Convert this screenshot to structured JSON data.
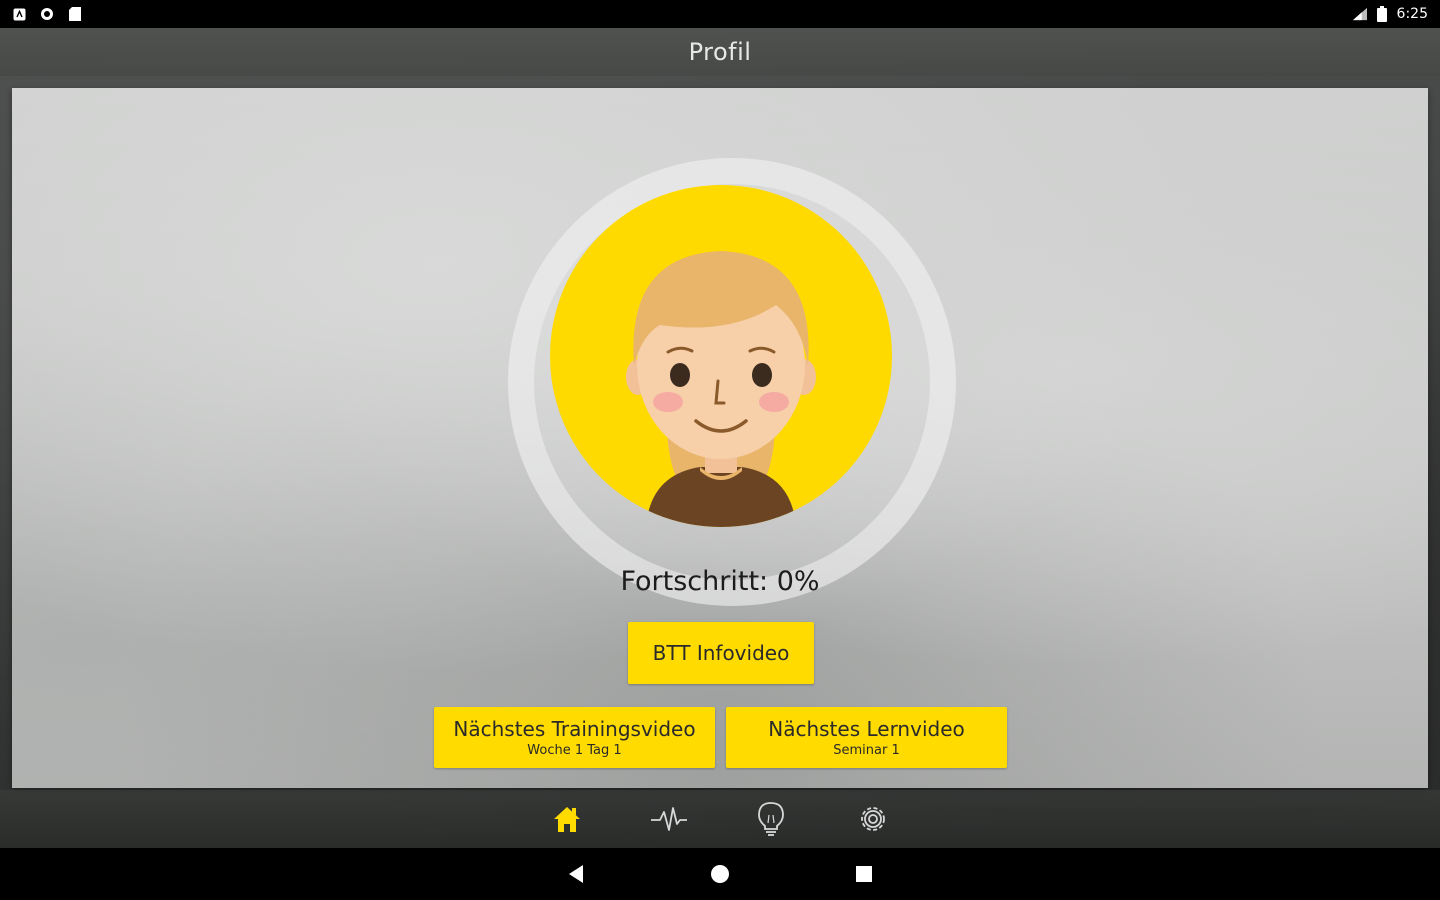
{
  "status_bar": {
    "time": "6:25",
    "left_icons": [
      "notification-a-icon",
      "sync-icon",
      "sd-card-icon"
    ],
    "right_icons": [
      "signal-icon",
      "battery-icon"
    ]
  },
  "header": {
    "title": "Profil"
  },
  "profile": {
    "avatar": "girl-avatar-icon",
    "progress_label": "Fortschritt: 0%",
    "progress_value": 0
  },
  "buttons": {
    "info_video": "BTT Infovideo",
    "next_training": {
      "title": "Nächstes Trainingsvideo",
      "subtitle": "Woche 1 Tag 1"
    },
    "next_learn": {
      "title": "Nächstes Lernvideo",
      "subtitle": "Seminar 1"
    }
  },
  "bottom_nav": [
    {
      "icon": "home-icon",
      "active": true
    },
    {
      "icon": "activity-icon",
      "active": false
    },
    {
      "icon": "lightbulb-icon",
      "active": false
    },
    {
      "icon": "settings-icon",
      "active": false
    }
  ],
  "android_nav": [
    "back-icon",
    "home-circle-icon",
    "recents-icon"
  ],
  "colors": {
    "accent": "#FFDB00",
    "text": "#1c1c1c"
  }
}
